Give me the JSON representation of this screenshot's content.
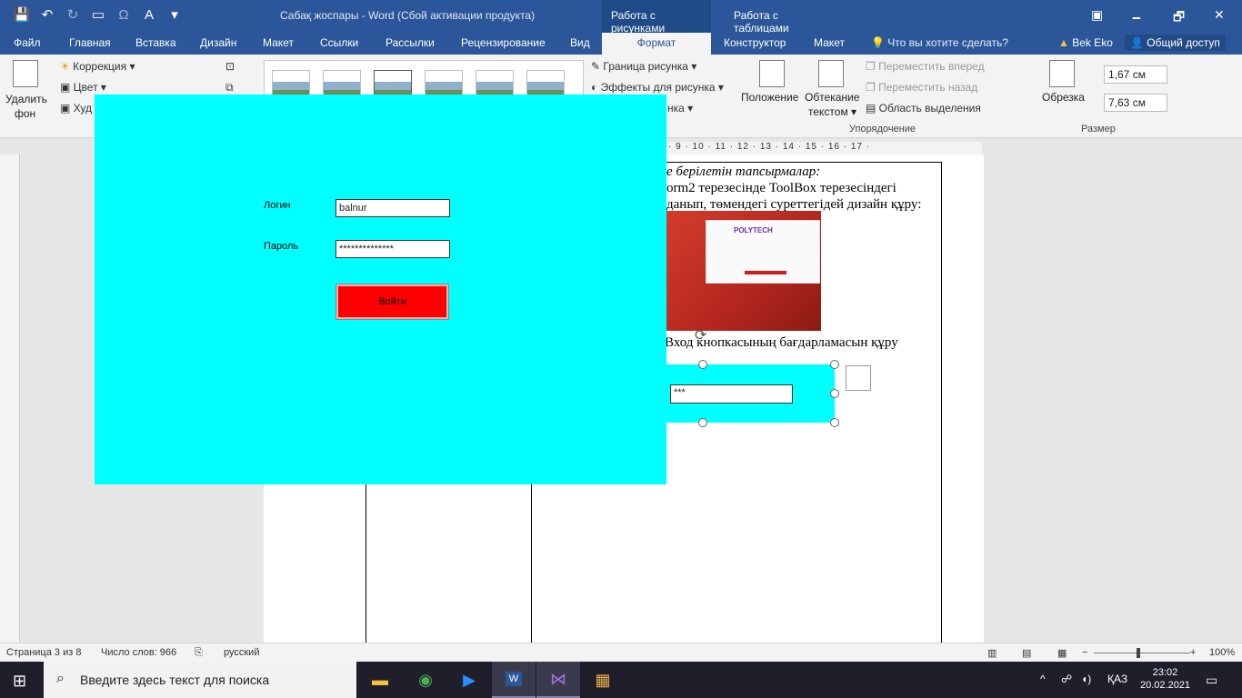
{
  "window": {
    "title": "Сабақ жоспары - Word (Сбой активации продукта)",
    "context_tab_picture": "Работа с рисунками",
    "context_tab_table": "Работа с таблицами",
    "min": "🗕",
    "restore": "🗗",
    "close": "✕"
  },
  "qat": {
    "save_icon": "💾",
    "undo_icon": "↶",
    "redo_icon": "↻",
    "table_icon": "▭",
    "omega_icon": "Ω",
    "font_color_icon": "A",
    "more_icon": "▾"
  },
  "tabs": [
    "Файл",
    "Главная",
    "Вставка",
    "Дизайн",
    "Макет",
    "Ссылки",
    "Рассылки",
    "Рецензирование",
    "Вид",
    "Формат",
    "Конструктор",
    "Макет"
  ],
  "tell_me": "Что вы хотите сделать?",
  "user": "Bek Eko",
  "share": "Общий доступ",
  "ribbon": {
    "remove_bg_line1": "Удалить",
    "remove_bg_line2": "фон",
    "correction": "Коррекция ▾",
    "color": "Цвет ▾",
    "artistic": "Худ",
    "border": "Граница рисунка ▾",
    "effects": "Эффекты для рисунка ▾",
    "layout_partial": "нка ▾",
    "position": "Положение",
    "wrap_line1": "Обтекание",
    "wrap_line2": "текстом ▾",
    "bring_forward": "Переместить вперед",
    "send_backward": "Переместить назад",
    "selection_pane": "Область выделения",
    "arrange_label": "Упорядочение",
    "crop": "Обрезка",
    "height": "1,67 см",
    "width": "7,63 см",
    "size_label": "Размер"
  },
  "ruler_numbers": "· 9 · 10 · 11 · 12 · 13 · 14 · 15 · 16 · 17 ·",
  "document": {
    "line1": "е берілетін тапсырмалар:",
    "line2": "orm2  терезесінде  ToolBox  терезесіндегі",
    "line3": "данып, төмендегі суреттегідей дизайн құру:",
    "line4": "Вход кнопкасының бағдарламасын құру",
    "shape_input_value": "***",
    "image_logo": "POLYTECH"
  },
  "form": {
    "login_label": "Логин",
    "login_value": "balnur",
    "password_label": "Пароль",
    "password_value": "**************",
    "submit_label": "Войти"
  },
  "status": {
    "page": "Страница 3 из 8",
    "words": "Число слов: 966",
    "language": "русский",
    "zoom": "100%"
  },
  "taskbar": {
    "search_placeholder": "Введите здесь текст для поиска",
    "lang": "ҚАЗ",
    "time": "23:02",
    "date": "20.02.2021"
  }
}
